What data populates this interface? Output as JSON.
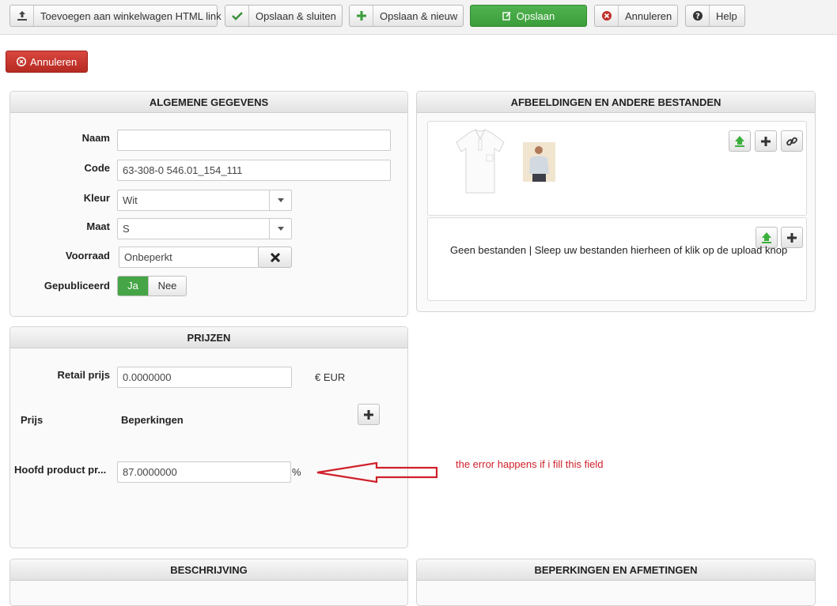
{
  "toolbar": {
    "add_to_cart_label": "Toevoegen aan winkelwagen HTML link",
    "save_close_label": "Opslaan & sluiten",
    "save_new_label": "Opslaan & nieuw",
    "save_label": "Opslaan",
    "cancel_label": "Annuleren",
    "help_label": "Help"
  },
  "cancel_button_label": "Annuleren",
  "general": {
    "title": "ALGEMENE GEGEVENS",
    "name_label": "Naam",
    "name_value": "",
    "code_label": "Code",
    "code_value": "63-308-0 546.01_154_111",
    "color_label": "Kleur",
    "color_value": "Wit",
    "size_label": "Maat",
    "size_value": "S",
    "stock_label": "Voorraad",
    "stock_value": "Onbeperkt",
    "published_label": "Gepubliceerd",
    "published_yes": "Ja",
    "published_no": "Nee"
  },
  "images": {
    "title": "AFBEELDINGEN EN ANDERE BESTANDEN",
    "no_files_text": "Geen bestanden | Sleep uw bestanden hierheen of klik op de upload knop"
  },
  "prices": {
    "title": "PRIJZEN",
    "retail_label": "Retail prijs",
    "retail_value": "0.0000000",
    "currency": "€ EUR",
    "price_col": "Prijs",
    "restrictions_col": "Beperkingen",
    "main_product_label": "Hoofd product pr...",
    "main_product_value": "87.0000000",
    "percent": "%"
  },
  "annotation": "the error happens if i fill this field",
  "description": {
    "title": "BESCHRIJVING"
  },
  "restrictions": {
    "title": "BEPERKINGEN EN AFMETINGEN"
  },
  "colors": {
    "green": "#46a546",
    "red": "#c0302a",
    "annotation_red": "#d0202a"
  }
}
